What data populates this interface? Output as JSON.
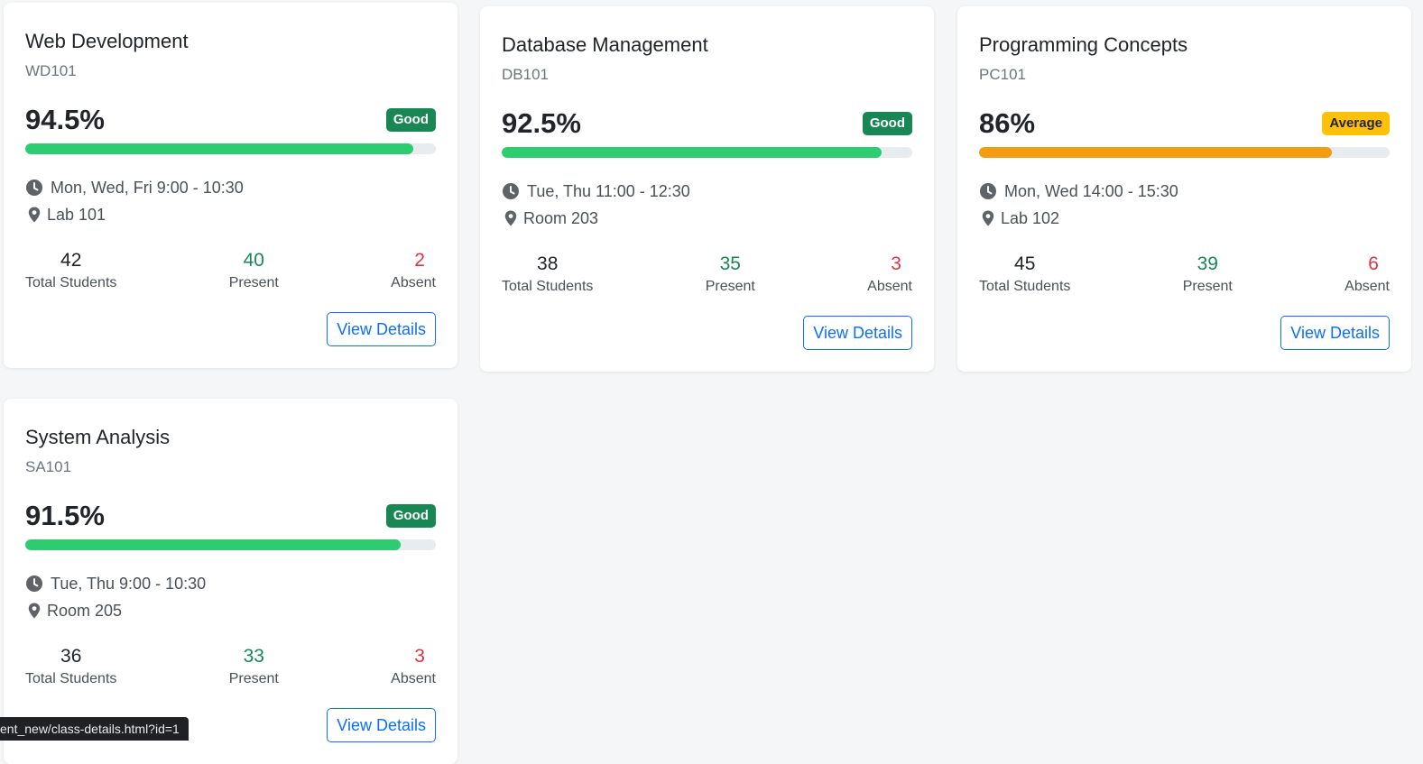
{
  "colors": {
    "good": "#198754",
    "average": "#ffc107",
    "bar_good": "#2ecc71",
    "bar_average": "#f39c12",
    "present": "#198754",
    "absent": "#dc3545",
    "link": "#0d6efd"
  },
  "cards": [
    {
      "title": "Web Development",
      "code": "WD101",
      "percent": "94.5%",
      "percent_value": 94.5,
      "status": "Good",
      "schedule": "Mon, Wed, Fri 9:00 - 10:30",
      "room": "Lab 101",
      "total": "42",
      "present": "40",
      "absent": "2",
      "total_label": "Total Students",
      "present_label": "Present",
      "absent_label": "Absent",
      "button": "View Details"
    },
    {
      "title": "Database Management",
      "code": "DB101",
      "percent": "92.5%",
      "percent_value": 92.5,
      "status": "Good",
      "schedule": "Tue, Thu 11:00 - 12:30",
      "room": "Room 203",
      "total": "38",
      "present": "35",
      "absent": "3",
      "total_label": "Total Students",
      "present_label": "Present",
      "absent_label": "Absent",
      "button": "View Details"
    },
    {
      "title": "Programming Concepts",
      "code": "PC101",
      "percent": "86%",
      "percent_value": 86,
      "status": "Average",
      "schedule": "Mon, Wed 14:00 - 15:30",
      "room": "Lab 102",
      "total": "45",
      "present": "39",
      "absent": "6",
      "total_label": "Total Students",
      "present_label": "Present",
      "absent_label": "Absent",
      "button": "View Details"
    },
    {
      "title": "System Analysis",
      "code": "SA101",
      "percent": "91.5%",
      "percent_value": 91.5,
      "status": "Good",
      "schedule": "Tue, Thu 9:00 - 10:30",
      "room": "Room 205",
      "total": "36",
      "present": "33",
      "absent": "3",
      "total_label": "Total Students",
      "present_label": "Present",
      "absent_label": "Absent",
      "button": "View Details"
    }
  ],
  "status_url": "ent_new/class-details.html?id=1"
}
